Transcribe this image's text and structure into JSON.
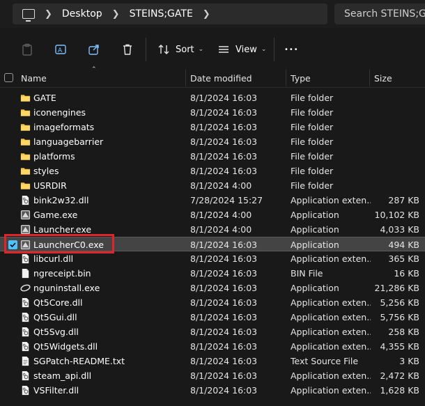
{
  "address": {
    "crumbs": [
      "Desktop",
      "STEINS;GATE"
    ],
    "search_placeholder": "Search STEINS;GATE"
  },
  "toolbar": {
    "sort_label": "Sort",
    "view_label": "View",
    "more_label": "•••"
  },
  "columns": {
    "name": "Name",
    "date": "Date modified",
    "type": "Type",
    "size": "Size"
  },
  "files": [
    {
      "name": "GATE",
      "date": "8/1/2024 16:03",
      "type": "File folder",
      "size": "",
      "icon": "folder-icon"
    },
    {
      "name": "iconengines",
      "date": "8/1/2024 16:03",
      "type": "File folder",
      "size": "",
      "icon": "folder-icon"
    },
    {
      "name": "imageformats",
      "date": "8/1/2024 16:03",
      "type": "File folder",
      "size": "",
      "icon": "folder-icon"
    },
    {
      "name": "languagebarrier",
      "date": "8/1/2024 16:03",
      "type": "File folder",
      "size": "",
      "icon": "folder-icon"
    },
    {
      "name": "platforms",
      "date": "8/1/2024 16:03",
      "type": "File folder",
      "size": "",
      "icon": "folder-icon"
    },
    {
      "name": "styles",
      "date": "8/1/2024 16:03",
      "type": "File folder",
      "size": "",
      "icon": "folder-icon"
    },
    {
      "name": "USRDIR",
      "date": "8/1/2024 4:00",
      "type": "File folder",
      "size": "",
      "icon": "folder-icon"
    },
    {
      "name": "bink2w32.dll",
      "date": "7/28/2024 15:27",
      "type": "Application exten...",
      "size": "287 KB",
      "icon": "dll-icon"
    },
    {
      "name": "Game.exe",
      "date": "8/1/2024 4:00",
      "type": "Application",
      "size": "10,102 KB",
      "icon": "exe-icon"
    },
    {
      "name": "Launcher.exe",
      "date": "8/1/2024 4:00",
      "type": "Application",
      "size": "4,033 KB",
      "icon": "exe-icon"
    },
    {
      "name": "LauncherC0.exe",
      "date": "8/1/2024 16:03",
      "type": "Application",
      "size": "494 KB",
      "icon": "exe-icon",
      "selected": true
    },
    {
      "name": "libcurl.dll",
      "date": "8/1/2024 16:03",
      "type": "Application exten...",
      "size": "365 KB",
      "icon": "dll-icon"
    },
    {
      "name": "ngreceipt.bin",
      "date": "8/1/2024 16:03",
      "type": "BIN File",
      "size": "16 KB",
      "icon": "file-icon"
    },
    {
      "name": "nguninstall.exe",
      "date": "8/1/2024 16:03",
      "type": "Application",
      "size": "21,286 KB",
      "icon": "uninstall-icon"
    },
    {
      "name": "Qt5Core.dll",
      "date": "8/1/2024 16:03",
      "type": "Application exten...",
      "size": "5,256 KB",
      "icon": "dll-icon"
    },
    {
      "name": "Qt5Gui.dll",
      "date": "8/1/2024 16:03",
      "type": "Application exten...",
      "size": "5,756 KB",
      "icon": "dll-icon"
    },
    {
      "name": "Qt5Svg.dll",
      "date": "8/1/2024 16:03",
      "type": "Application exten...",
      "size": "258 KB",
      "icon": "dll-icon"
    },
    {
      "name": "Qt5Widgets.dll",
      "date": "8/1/2024 16:03",
      "type": "Application exten...",
      "size": "4,355 KB",
      "icon": "dll-icon"
    },
    {
      "name": "SGPatch-README.txt",
      "date": "8/1/2024 16:03",
      "type": "Text Source File",
      "size": "3 KB",
      "icon": "text-file-icon"
    },
    {
      "name": "steam_api.dll",
      "date": "8/1/2024 16:03",
      "type": "Application exten...",
      "size": "2,472 KB",
      "icon": "dll-icon"
    },
    {
      "name": "VSFilter.dll",
      "date": "8/1/2024 16:03",
      "type": "Application exten...",
      "size": "1,628 KB",
      "icon": "dll-icon"
    }
  ],
  "colors": {
    "background": "#191919",
    "folder": "#f4c247",
    "selection": "#444444",
    "accent_check": "#4cc2ff",
    "highlight_box": "#e0242a"
  }
}
